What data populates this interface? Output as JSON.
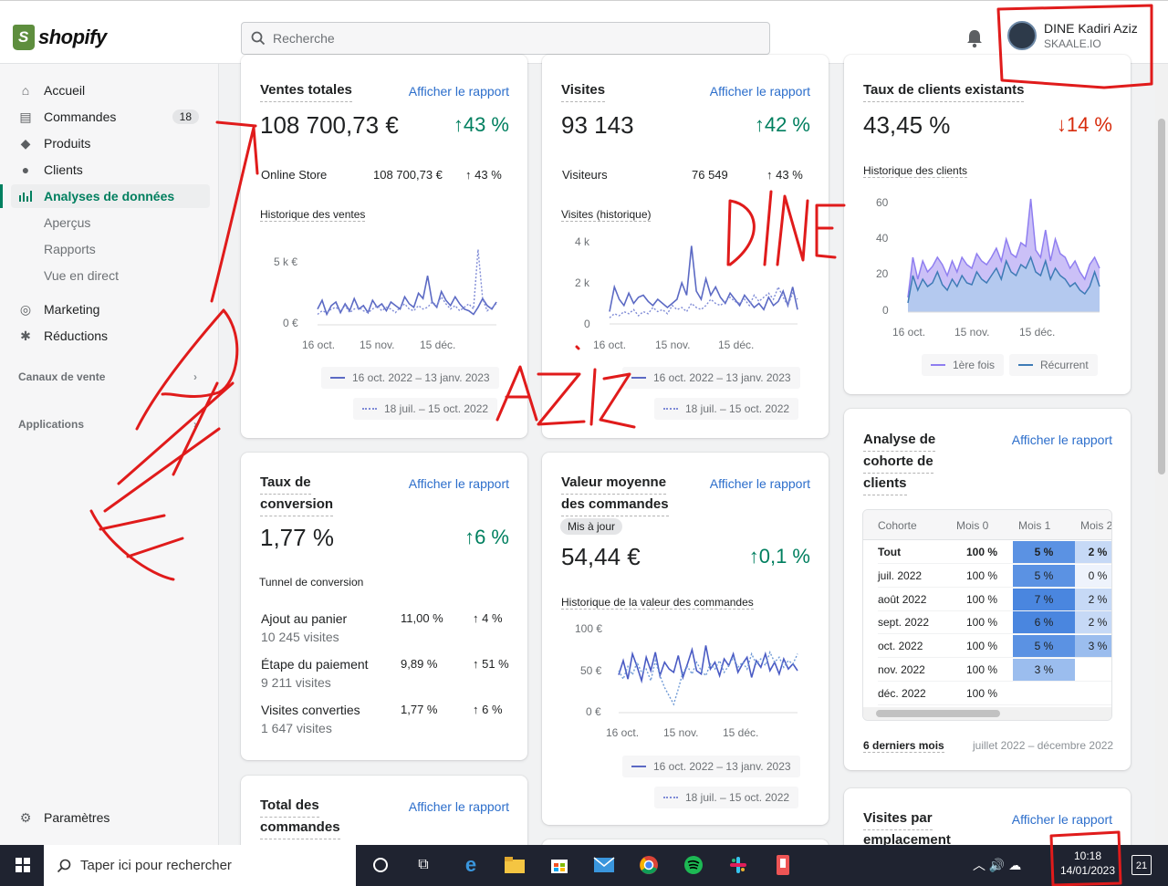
{
  "brand": {
    "name": "shopify"
  },
  "search": {
    "placeholder": "Recherche"
  },
  "user": {
    "name": "DINE Kadiri Aziz",
    "shop": "SKAALE.IO"
  },
  "sidebar": {
    "items": [
      {
        "label": "Accueil",
        "icon": "home-icon"
      },
      {
        "label": "Commandes",
        "icon": "orders-icon",
        "badge": "18"
      },
      {
        "label": "Produits",
        "icon": "tag-icon"
      },
      {
        "label": "Clients",
        "icon": "person-icon"
      },
      {
        "label": "Analyses de données",
        "icon": "analytics-icon"
      }
    ],
    "sub_items": [
      "Aperçus",
      "Rapports",
      "Vue en direct"
    ],
    "items2": [
      {
        "label": "Marketing",
        "icon": "target-icon"
      },
      {
        "label": "Réductions",
        "icon": "discount-icon"
      }
    ],
    "sections": [
      "Canaux de vente",
      "Applications"
    ],
    "settings": "Paramètres"
  },
  "link_label": "Afficher le rapport",
  "cards": {
    "sales": {
      "title": "Ventes totales",
      "value": "108 700,73 €",
      "delta": "43 %",
      "row_label": "Online Store",
      "row_value": "108 700,73 €",
      "row_delta": "43 %",
      "chart_title": "Historique des ventes",
      "y_ticks": [
        "5 k €",
        "0 €"
      ],
      "x_ticks": [
        "16 oct.",
        "15 nov.",
        "15 déc."
      ],
      "legend_current": "16 oct. 2022 – 13 janv. 2023",
      "legend_previous": "18 juil. – 15 oct. 2022"
    },
    "visits": {
      "title": "Visites",
      "value": "93 143",
      "delta": "42 %",
      "row_label": "Visiteurs",
      "row_value": "76 549",
      "row_delta": "43 %",
      "chart_title": "Visites (historique)",
      "y_ticks": [
        "4 k",
        "2 k",
        "0"
      ],
      "x_ticks": [
        "16 oct.",
        "15 nov.",
        "15 déc."
      ],
      "legend_current": "16 oct. 2022 – 13 janv. 2023",
      "legend_previous": "18 juil. – 15 oct. 2022"
    },
    "returning": {
      "title": "Taux de clients existants",
      "value": "43,45 %",
      "delta": "14 %",
      "chart_title": "Historique des clients",
      "y_ticks": [
        "60",
        "40",
        "20",
        "0"
      ],
      "x_ticks": [
        "16 oct.",
        "15 nov.",
        "15 déc."
      ],
      "legend_first": "1ère fois",
      "legend_returning": "Récurrent"
    },
    "conversion": {
      "title_l1": "Taux de",
      "title_l2": "conversion",
      "value": "1,77 %",
      "delta": "6 %",
      "funnel_title": "Tunnel de conversion",
      "rows": [
        {
          "label": "Ajout au panier",
          "visits": "10 245 visites",
          "pct": "11,00 %",
          "delta": "4 %"
        },
        {
          "label": "Étape du paiement",
          "visits": "9 211 visites",
          "pct": "9,89 %",
          "delta": "51 %"
        },
        {
          "label": "Visites converties",
          "visits": "1 647 visites",
          "pct": "1,77 %",
          "delta": "6 %"
        }
      ]
    },
    "aov": {
      "title_l1": "Valeur moyenne",
      "title_l2": "des commandes",
      "pill": "Mis à jour",
      "value": "54,44 €",
      "delta": "0,1 %",
      "chart_title": "Historique de la valeur des commandes",
      "y_ticks": [
        "100 €",
        "50 €",
        "0 €"
      ],
      "x_ticks": [
        "16 oct.",
        "15 nov.",
        "15 déc."
      ],
      "legend_current": "16 oct. 2022 – 13 janv. 2023",
      "legend_previous": "18 juil. – 15 oct. 2022"
    },
    "cohort": {
      "title_l1": "Analyse de",
      "title_l2": "cohorte de",
      "title_l3": "clients",
      "headers": [
        "Cohorte",
        "Mois 0",
        "Mois 1",
        "Mois 2"
      ],
      "rows": [
        {
          "cohort": "Tout",
          "m0": "100 %",
          "m1": "5 %",
          "m2": "2 %"
        },
        {
          "cohort": "juil. 2022",
          "m0": "100 %",
          "m1": "5 %",
          "m2": "0 %"
        },
        {
          "cohort": "août 2022",
          "m0": "100 %",
          "m1": "7 %",
          "m2": "2 %"
        },
        {
          "cohort": "sept. 2022",
          "m0": "100 %",
          "m1": "6 %",
          "m2": "2 %"
        },
        {
          "cohort": "oct. 2022",
          "m0": "100 %",
          "m1": "5 %",
          "m2": "3 %"
        },
        {
          "cohort": "nov. 2022",
          "m0": "100 %",
          "m1": "3 %",
          "m2": ""
        },
        {
          "cohort": "déc. 2022",
          "m0": "100 %",
          "m1": "",
          "m2": ""
        }
      ],
      "footer_left": "6 derniers mois",
      "footer_right": "juillet 2022 – décembre 2022"
    },
    "orders": {
      "title_l1": "Total des",
      "title_l2": "commandes"
    },
    "location": {
      "title_l1": "Visites par",
      "title_l2": "emplacement"
    }
  },
  "taskbar": {
    "search_placeholder": "Taper ici pour rechercher",
    "time": "10:18",
    "date": "14/01/2023",
    "notif_count": "21"
  },
  "annotations": {
    "text1": "DINE",
    "text2": "DINE",
    "text3": "AZIZ"
  },
  "chart_data": [
    {
      "type": "line",
      "title": "Historique des ventes",
      "x_range": [
        "16 oct. 2022",
        "13 janv. 2023"
      ],
      "ylim": [
        0,
        5000
      ],
      "x_ticks": [
        "16 oct.",
        "15 nov.",
        "15 déc."
      ],
      "series": [
        {
          "name": "16 oct. 2022 – 13 janv. 2023",
          "values": [
            900,
            1400,
            600,
            1100,
            1300,
            700,
            1200,
            800,
            1500,
            900,
            1100,
            700,
            1400,
            1000,
            1200,
            800,
            1300,
            1100,
            900,
            1600,
            1200,
            1000,
            1800,
            1500,
            2800,
            1300,
            1000,
            1900,
            1400,
            1100,
            1600,
            1200,
            900,
            800,
            600,
            1000,
            1500,
            1100,
            900,
            1300
          ]
        },
        {
          "name": "18 juil. – 15 oct. 2022",
          "values": [
            600,
            800,
            700,
            900,
            1000,
            800,
            1100,
            700,
            900,
            1000,
            800,
            700,
            900,
            1100,
            800,
            1000,
            900,
            700,
            1000,
            1200,
            900,
            800,
            1100,
            900,
            1000,
            1300,
            1100,
            1600,
            1200,
            900,
            1100,
            800,
            1000,
            1200,
            900,
            4300,
            1500,
            800,
            1000,
            1200
          ]
        }
      ]
    },
    {
      "type": "line",
      "title": "Visites (historique)",
      "ylim": [
        0,
        4000
      ],
      "x_ticks": [
        "16 oct.",
        "15 nov.",
        "15 déc."
      ],
      "series": [
        {
          "name": "16 oct. 2022 – 13 janv. 2023",
          "values": [
            600,
            1800,
            1200,
            900,
            1500,
            1000,
            1300,
            1400,
            1100,
            900,
            1200,
            1000,
            800,
            1000,
            1200,
            2000,
            1400,
            3800,
            1600,
            1200,
            2200,
            1400,
            1800,
            1300,
            1000,
            1500,
            1200,
            900,
            1400,
            1100,
            800,
            1000,
            700,
            1300,
            900,
            1100,
            1600,
            900,
            1800,
            700
          ]
        },
        {
          "name": "18 juil. – 15 oct. 2022",
          "values": [
            300,
            500,
            400,
            600,
            500,
            700,
            400,
            600,
            500,
            800,
            600,
            700,
            500,
            900,
            700,
            800,
            600,
            1000,
            800,
            700,
            900,
            1200,
            1000,
            900,
            1100,
            1300,
            1100,
            1000,
            1200,
            900,
            1400,
            1100,
            1300,
            1500,
            1200,
            1800,
            1300,
            900,
            1500,
            1200
          ]
        }
      ]
    },
    {
      "type": "area",
      "title": "Historique des clients",
      "ylim": [
        0,
        60
      ],
      "x_ticks": [
        "16 oct.",
        "15 nov.",
        "15 déc."
      ],
      "series": [
        {
          "name": "1ère fois",
          "values": [
            8,
            30,
            18,
            28,
            22,
            25,
            30,
            26,
            20,
            28,
            22,
            30,
            26,
            24,
            32,
            28,
            26,
            30,
            35,
            28,
            40,
            32,
            30,
            38,
            36,
            62,
            34,
            30,
            45,
            28,
            40,
            32,
            30,
            24,
            28,
            22,
            18,
            26,
            30,
            24
          ]
        },
        {
          "name": "Récurrent",
          "values": [
            5,
            20,
            12,
            18,
            14,
            16,
            22,
            15,
            12,
            18,
            14,
            20,
            16,
            15,
            22,
            18,
            16,
            20,
            24,
            18,
            28,
            22,
            20,
            26,
            24,
            30,
            22,
            20,
            28,
            18,
            24,
            20,
            18,
            14,
            16,
            12,
            10,
            14,
            22,
            14
          ]
        }
      ]
    },
    {
      "type": "line",
      "title": "Historique de la valeur des commandes",
      "ylim": [
        0,
        100
      ],
      "x_ticks": [
        "16 oct.",
        "15 nov.",
        "15 déc."
      ],
      "series": [
        {
          "name": "16 oct. 2022 – 13 janv. 2023",
          "values": [
            45,
            62,
            40,
            70,
            55,
            38,
            66,
            50,
            72,
            44,
            60,
            52,
            48,
            68,
            42,
            58,
            75,
            50,
            46,
            80,
            52,
            60,
            44,
            64,
            56,
            70,
            48,
            58,
            66,
            42,
            62,
            54,
            70,
            50,
            60,
            46,
            64,
            52,
            58,
            50
          ]
        },
        {
          "name": "18 juil. – 15 oct. 2022",
          "values": [
            50,
            40,
            55,
            45,
            60,
            48,
            52,
            38,
            62,
            44,
            30,
            20,
            10,
            28,
            48,
            55,
            46,
            60,
            50,
            44,
            58,
            52,
            62,
            48,
            56,
            66,
            54,
            60,
            52,
            70,
            58,
            64,
            56,
            72,
            60,
            66,
            54,
            62,
            58,
            70
          ]
        }
      ]
    }
  ]
}
